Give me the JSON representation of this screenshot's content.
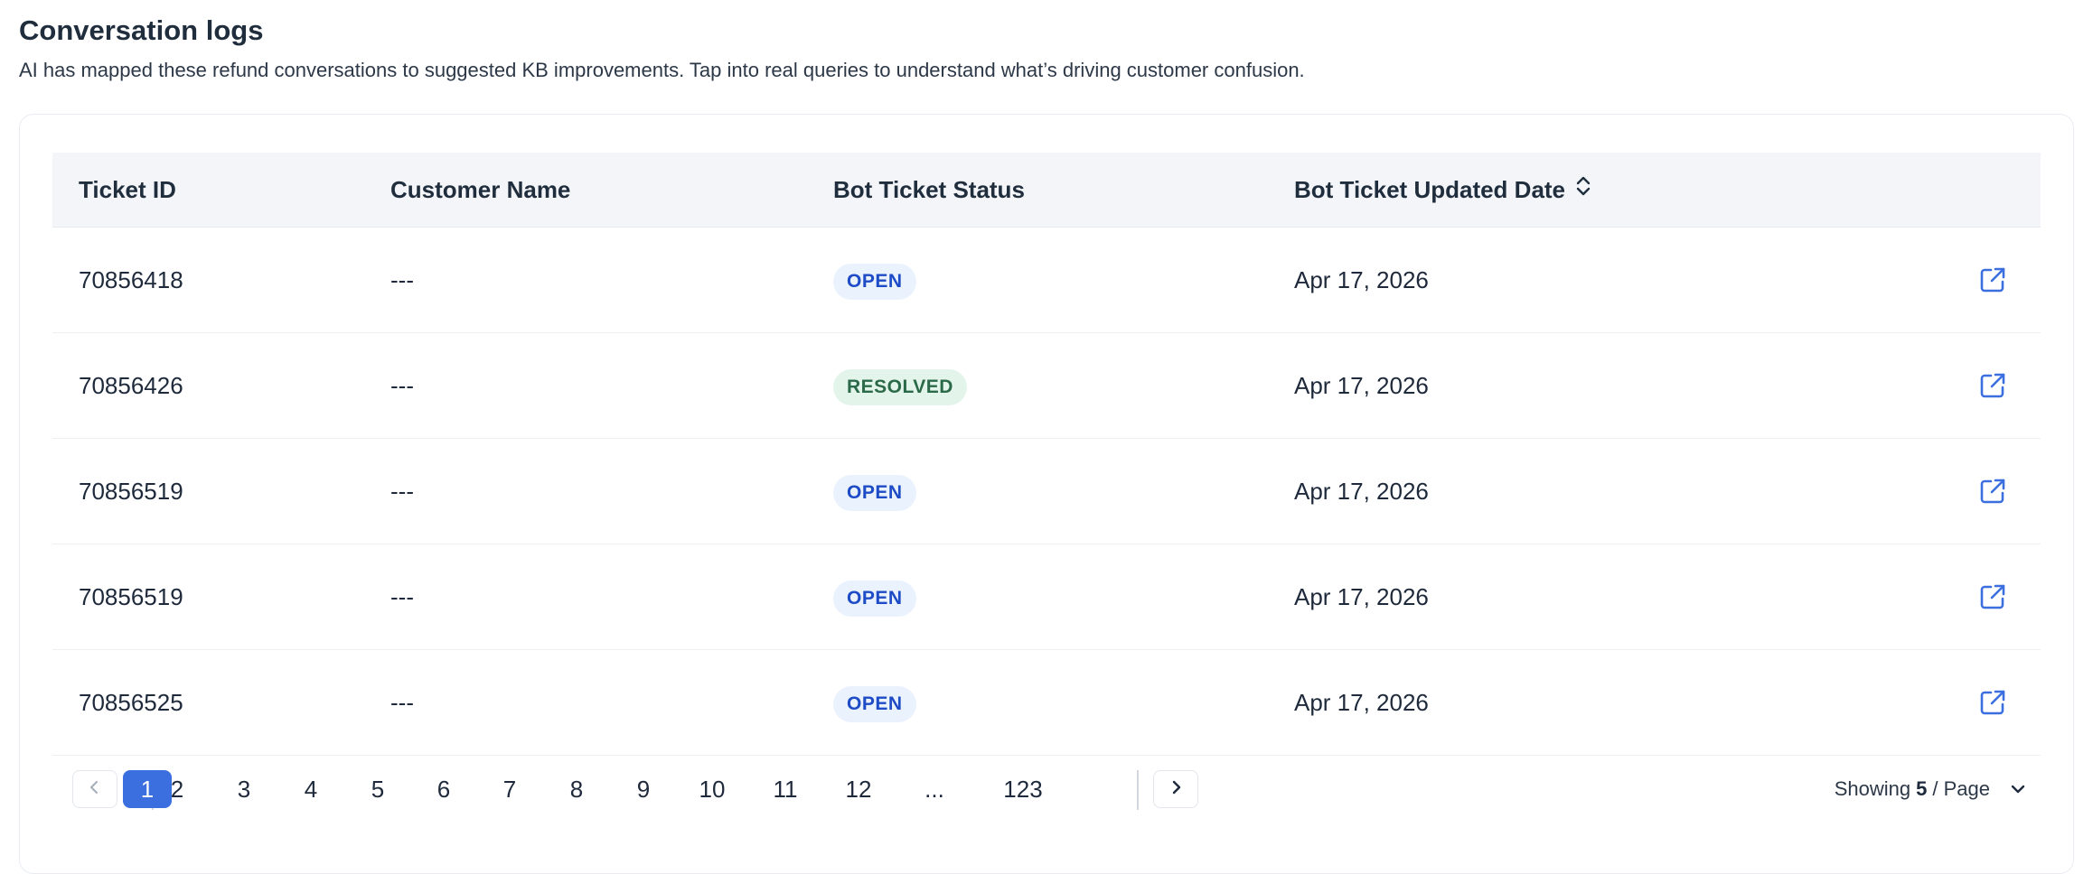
{
  "header": {
    "title": "Conversation logs",
    "subtitle": "AI has mapped these refund conversations to suggested KB improvements. Tap into real queries to understand what’s driving customer confusion."
  },
  "table": {
    "columns": [
      "Ticket ID",
      "Customer Name",
      "Bot Ticket Status",
      "Bot Ticket Updated Date"
    ],
    "sort_icon": "sort-icon",
    "row_action_icon": "external-link-icon",
    "rows": [
      {
        "ticket_id": "70856418",
        "customer": "---",
        "status": "OPEN",
        "date": "Apr 17, 2026"
      },
      {
        "ticket_id": "70856426",
        "customer": "---",
        "status": "RESOLVED",
        "date": "Apr 17, 2026"
      },
      {
        "ticket_id": "70856519",
        "customer": "---",
        "status": "OPEN",
        "date": "Apr 17, 2026"
      },
      {
        "ticket_id": "70856519",
        "customer": "---",
        "status": "OPEN",
        "date": "Apr 17, 2026"
      },
      {
        "ticket_id": "70856525",
        "customer": "---",
        "status": "OPEN",
        "date": "Apr 17, 2026"
      }
    ]
  },
  "pagination": {
    "pages": [
      "1",
      "2",
      "3",
      "4",
      "5",
      "6",
      "7",
      "8",
      "9",
      "10",
      "11",
      "12",
      "...",
      "123"
    ],
    "current": "1",
    "showing_prefix": "Showing",
    "page_size": "5",
    "showing_suffix": "/ Page"
  },
  "colors": {
    "accent": "#3b6fe0",
    "open_badge_bg": "#eaf2fe",
    "open_badge_text": "#1e4bc6",
    "resolved_badge_bg": "#e3f4ea",
    "resolved_badge_text": "#2b6a48"
  }
}
